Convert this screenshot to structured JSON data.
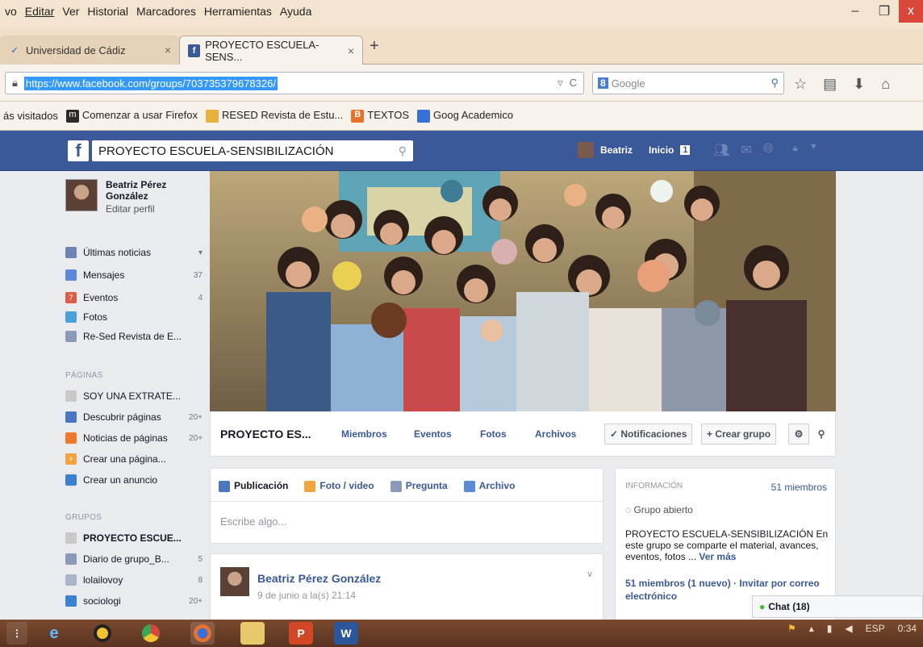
{
  "browser": {
    "menus": [
      "vo",
      "Editar",
      "Ver",
      "Historial",
      "Marcadores",
      "Herramientas",
      "Ayuda"
    ],
    "tabs": [
      {
        "label": "Universidad de Cádiz",
        "close": "×"
      },
      {
        "label": "PROYECTO ESCUELA-SENS...",
        "close": "×"
      }
    ],
    "new_tab": "+",
    "url": "https://www.facebook.com/groups/703735379678326/",
    "url_right": [
      "▿",
      "C"
    ],
    "search_engine": "8",
    "search_placeholder": "Google",
    "bookmarks": [
      {
        "label": "ás visitados",
        "color": ""
      },
      {
        "label": "Comenzar a usar Firefox",
        "color": "#2b2b2b",
        "glyph": "m"
      },
      {
        "label": "RESED Revista de Estu...",
        "color": "#e8b23a"
      },
      {
        "label": "TEXTOS",
        "color": "#e8712c",
        "glyph": "B"
      },
      {
        "label": "Goog Academico",
        "color": "#3a6fd8"
      }
    ]
  },
  "fb": {
    "search_text": "PROYECTO ESCUELA-SENSIBILIZACIÓN",
    "user_name": "Beatriz",
    "home_label": "Inicio",
    "home_count": "1",
    "profile": {
      "name": "Beatriz Pérez González",
      "edit": "Editar perfil"
    },
    "nav": [
      {
        "label": "Últimas noticias",
        "count": "▾",
        "color": "#6d84b4"
      },
      {
        "label": "Mensajes",
        "count": "37",
        "color": "#5b8ad8"
      },
      {
        "label": "Eventos",
        "count": "4",
        "color": "#e05a46"
      },
      {
        "label": "Fotos",
        "count": "",
        "color": "#4aa3d8"
      },
      {
        "label": "Re-Sed Revista de E...",
        "count": "",
        "color": "#8a9ab8"
      }
    ],
    "pages_header": "PÁGINAS",
    "pages": [
      {
        "label": "SOY UNA EXTRATE...",
        "count": "",
        "color": "#c9c9c9"
      },
      {
        "label": "Descubrir páginas",
        "count": "20+",
        "color": "#4a76c2"
      },
      {
        "label": "Noticias de páginas",
        "count": "20+",
        "color": "#f07a2b"
      },
      {
        "label": "Crear una página...",
        "count": "",
        "color": "#f2a53c"
      },
      {
        "label": "Crear un anuncio",
        "count": "",
        "color": "#3b82d0"
      }
    ],
    "groups_header": "GRUPOS",
    "groups": [
      {
        "label": "PROYECTO ESCUE...",
        "count": "",
        "color": "#c9c9c9",
        "bold": true
      },
      {
        "label": "Diario de grupo_B...",
        "count": "5",
        "color": "#8a9ab8"
      },
      {
        "label": "lolailovoy",
        "count": "8",
        "color": "#8a9ab8"
      },
      {
        "label": "sociologi",
        "count": "20+",
        "color": "#3b82d0"
      }
    ],
    "group_name": "PROYECTO ES...",
    "group_tabs": [
      "Miembros",
      "Eventos",
      "Fotos",
      "Archivos"
    ],
    "notif_btn": "✓ Notificaciones",
    "create_btn": "+ Crear grupo",
    "composer_tabs": [
      "Publicación",
      "Foto / video",
      "Pregunta",
      "Archivo"
    ],
    "composer_placeholder": "Escribe algo...",
    "post": {
      "author": "Beatriz Pérez González",
      "date": "9 de junio a la(s) 21:14"
    },
    "info": {
      "header": "INFORMACIÓN",
      "members": "51 miembros",
      "open": "Grupo abierto",
      "desc": "PROYECTO ESCUELA-SENSIBILIZACIÓN En este grupo se comparte el material, avances, eventos, fotos ...",
      "more": "Ver más",
      "links": "51 miembros (1 nuevo) · Invitar por correo electrónico"
    },
    "chat": "Chat (18)"
  },
  "taskbar": {
    "lang": "ESP",
    "time": "0:34"
  }
}
